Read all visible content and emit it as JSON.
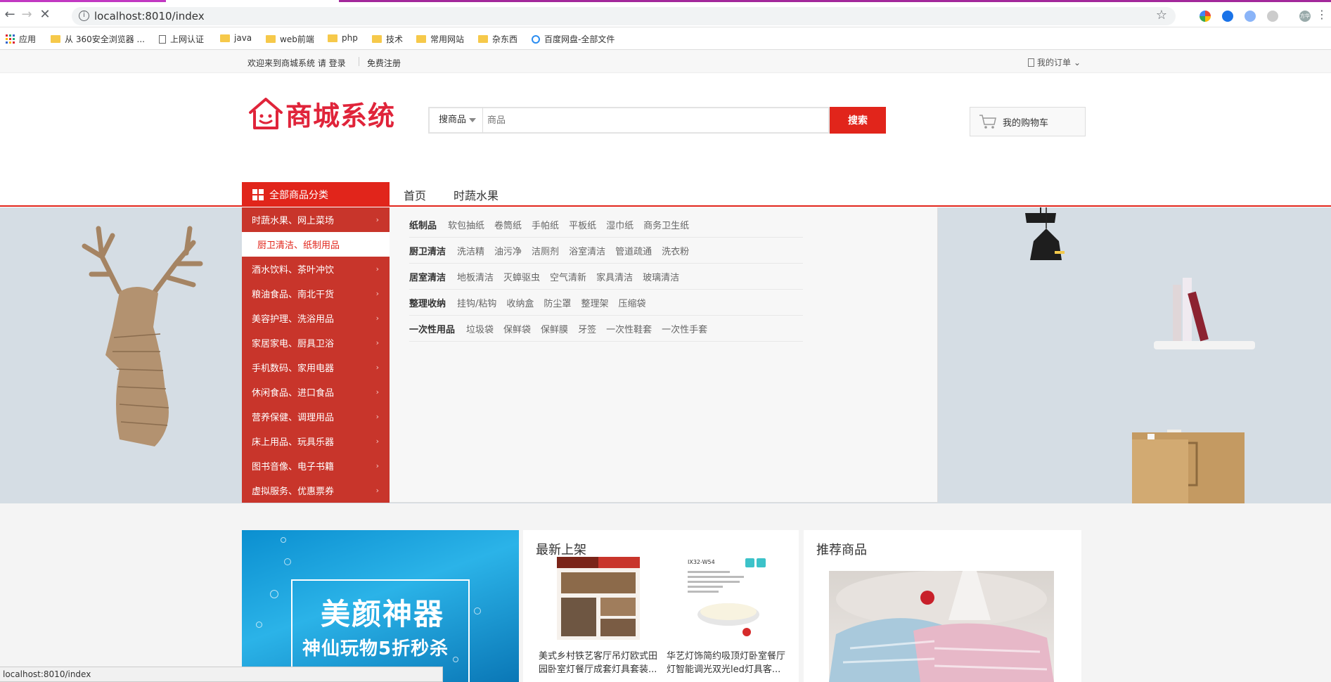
{
  "browser": {
    "url": "localhost:8010/index",
    "bookmarks": [
      "应用",
      "从 360安全浏览器 ...",
      "上网认证",
      "java",
      "web前端",
      "php",
      "技术",
      "常用网站",
      "杂东西",
      "百度网盘-全部文件"
    ],
    "profile": "方华"
  },
  "site_top": {
    "welcome": "欢迎来到商城系统 请 登录",
    "register": "免费注册",
    "orders": "我的订单"
  },
  "header": {
    "logo_text": "商城系统",
    "search_category": "搜商品",
    "search_placeholder": "商品",
    "search_button": "搜索",
    "cart_label": "我的购物车"
  },
  "nav": {
    "all_categories": "全部商品分类",
    "links": [
      "首页",
      "时蔬水果"
    ]
  },
  "sidebar": {
    "items": [
      {
        "label": "时蔬水果、网上菜场"
      },
      {
        "label": "厨卫清洁、纸制用品"
      },
      {
        "label": "酒水饮料、茶叶冲饮"
      },
      {
        "label": "粮油食品、南北干货"
      },
      {
        "label": "美容护理、洗浴用品"
      },
      {
        "label": "家居家电、厨具卫浴"
      },
      {
        "label": "手机数码、家用电器"
      },
      {
        "label": "休闲食品、进口食品"
      },
      {
        "label": "营养保健、调理用品"
      },
      {
        "label": "床上用品、玩具乐器"
      },
      {
        "label": "图书音像、电子书籍"
      },
      {
        "label": "虚拟服务、优惠票券"
      }
    ],
    "active_index": 1
  },
  "popup": {
    "rows": [
      {
        "title": "纸制品",
        "items": [
          "软包抽纸",
          "卷筒纸",
          "手帕纸",
          "平板纸",
          "湿巾纸",
          "商务卫生纸"
        ]
      },
      {
        "title": "厨卫清洁",
        "items": [
          "洗洁精",
          "油污净",
          "洁厕剂",
          "浴室清洁",
          "管道疏通",
          "洗衣粉"
        ]
      },
      {
        "title": "居室清洁",
        "items": [
          "地板清洁",
          "灭蟑驱虫",
          "空气清新",
          "家具清洁",
          "玻璃清洁"
        ]
      },
      {
        "title": "整理收纳",
        "items": [
          "挂钩/粘钩",
          "收纳盒",
          "防尘罩",
          "整理架",
          "压缩袋"
        ]
      },
      {
        "title": "一次性用品",
        "items": [
          "垃圾袋",
          "保鲜袋",
          "保鲜膜",
          "牙签",
          "一次性鞋套",
          "一次性手套"
        ]
      }
    ]
  },
  "promo": {
    "title": "美颜神器",
    "subtitle": "神仙玩物5折秒杀"
  },
  "new_arrivals": {
    "title": "最新上架",
    "products": [
      {
        "name": "美式乡村铁艺客厅吊灯欧式田园卧室灯餐厅成套灯具套装..."
      },
      {
        "name": "华艺灯饰简约吸顶灯卧室餐厅灯智能调光双光led灯具客..."
      }
    ],
    "tag_text": "IX32-W54"
  },
  "recommend": {
    "title": "推荐商品"
  },
  "status_bar": "localhost:8010/index",
  "colors": {
    "brand_red": "#e1251b",
    "sidebar_red": "#c8352b",
    "logo_red": "#e0243a"
  }
}
